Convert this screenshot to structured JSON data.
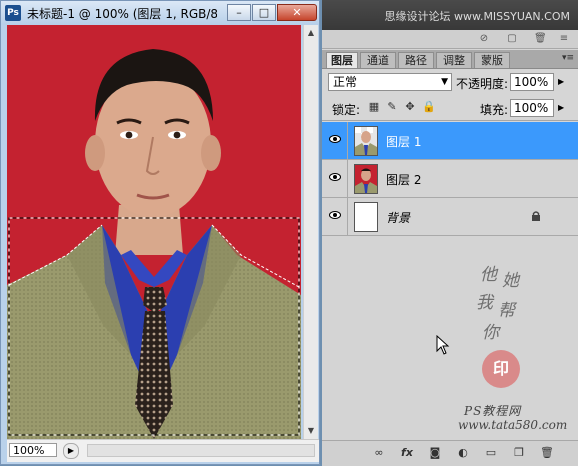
{
  "document": {
    "app_badge": "Ps",
    "title": "未标题-1 @ 100% (图层 1, RGB/8...",
    "zoom": "100%",
    "window_buttons": {
      "minimize": "–",
      "maximize": "□",
      "close": "✕"
    }
  },
  "panel": {
    "watermark": "思缘设计论坛 www.MISSYUAN.COM",
    "tabs": [
      "图层",
      "通道",
      "路径",
      "调整",
      "蒙版"
    ],
    "active_tab": "图层",
    "blend_mode": "正常",
    "opacity_label": "不透明度:",
    "opacity_value": "100%",
    "lock_label": "锁定:",
    "fill_label": "填充:",
    "fill_value": "100%",
    "layers": [
      {
        "name": "图层 1",
        "selected": true,
        "visible": true
      },
      {
        "name": "图层 2",
        "selected": false,
        "visible": true
      },
      {
        "name": "背景",
        "selected": false,
        "visible": true,
        "locked": true
      }
    ],
    "calligraphy": [
      "他",
      "她",
      "我",
      "帮",
      "你"
    ],
    "seal_text": "印",
    "site_line1": "PS教程网",
    "site_line2": "www.tata580.com"
  },
  "colors": {
    "selected_layer": "#3b99fc",
    "photo_background": "#c42230",
    "suit": "#9b9b6e",
    "shirt": "#2b3fb0"
  },
  "icons": {
    "eye": "eye-icon",
    "lock": "lock-icon",
    "link": "link-icon",
    "fx": "fx-icon",
    "mask": "mask-icon",
    "adjustment": "adjustment-icon",
    "folder": "folder-icon",
    "new_layer": "new-layer-icon",
    "trash": "trash-icon"
  }
}
